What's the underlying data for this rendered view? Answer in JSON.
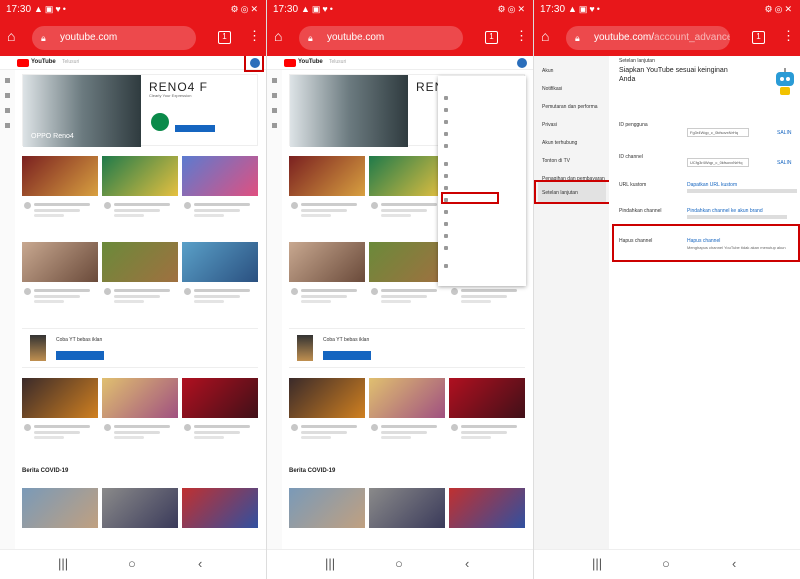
{
  "status": {
    "time": "17:30"
  },
  "chrome": {
    "url_main": "youtube.com",
    "url3_main": "youtube.com/",
    "url3_path": "account_advanced",
    "tab_count": "1"
  },
  "youtube": {
    "logo_text": "YouTube",
    "search_placeholder": "Telusuri",
    "banner_caption": "OPPO Reno4",
    "banner_title": "RENO4 F",
    "banner_tagline": "Clearly Your Expression",
    "promo_title": "Coba YT bebas iklan",
    "covid_heading": "Berita COVID-19"
  },
  "settings": {
    "breadcrumb": "Setelan lanjutan",
    "headline": "Siapkan YouTube sesuai keinginan Anda",
    "sidebar": [
      "Akun",
      "Notifikasi",
      "Pemutaran dan performa",
      "Privasi",
      "Akun terhubung",
      "Tonton di TV",
      "Penagihan dan pembayaran",
      "Setelan lanjutan"
    ],
    "user_id_label": "ID pengguna",
    "channel_id_label": "ID channel",
    "custom_url_label": "URL kustom",
    "move_channel_label": "Pindahkan channel",
    "delete_channel_label": "Hapus channel",
    "user_id_value": "Fg3r4Wqp_c_0kfsovxNrHq",
    "channel_id_value": "UCfg3r4Wqp_c_0kfsovxNrHq",
    "copy": "SALIN",
    "custom_url_link": "Dapatkan URL kustom",
    "move_channel_link": "Pindahkan channel ke akun brand",
    "delete_channel_link": "Hapus channel",
    "delete_desc": "Menghapus channel YouTube tidak akan menutup akun"
  },
  "colors": {
    "chrome_red": "#e8171a",
    "highlight": "#cc0000",
    "link_blue": "#1565c0"
  }
}
